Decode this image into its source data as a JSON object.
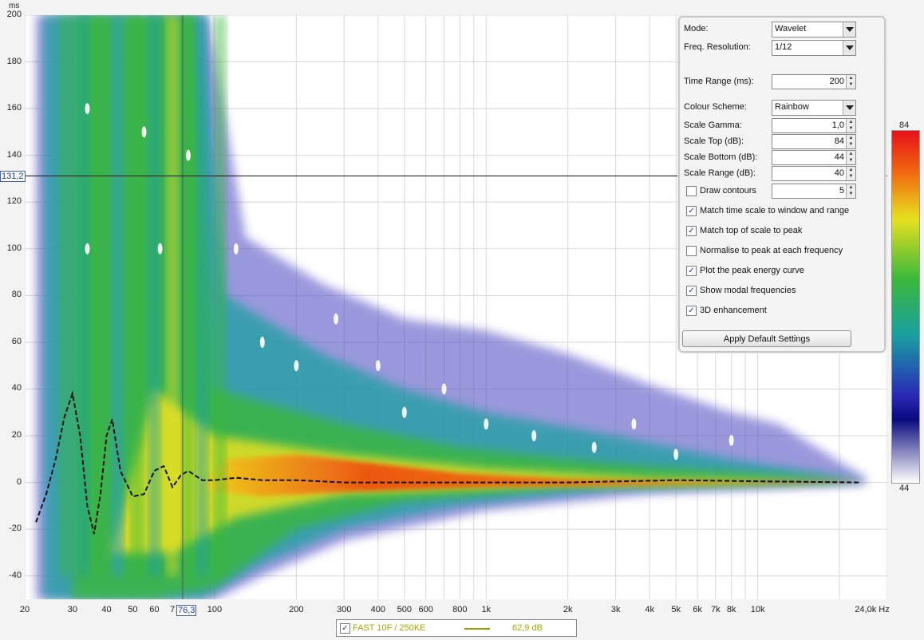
{
  "chart_data": {
    "type": "heatmap",
    "subtype": "wavelet spectrogram",
    "x_unit": "Hz",
    "y_unit": "ms",
    "x_scale": "log",
    "xlim": [
      20,
      30000
    ],
    "ylim": [
      -50,
      200
    ],
    "grid": true,
    "x_ticks": [
      {
        "value": 20,
        "label": "20"
      },
      {
        "value": 30,
        "label": "30"
      },
      {
        "value": 40,
        "label": "40"
      },
      {
        "value": 50,
        "label": "50"
      },
      {
        "value": 60,
        "label": "60"
      },
      {
        "value": 70,
        "label": "7"
      },
      {
        "value": 100,
        "label": "100"
      },
      {
        "value": 200,
        "label": "200"
      },
      {
        "value": 300,
        "label": "300"
      },
      {
        "value": 400,
        "label": "400"
      },
      {
        "value": 500,
        "label": "500"
      },
      {
        "value": 600,
        "label": "600"
      },
      {
        "value": 800,
        "label": "800"
      },
      {
        "value": 1000,
        "label": "1k"
      },
      {
        "value": 2000,
        "label": "2k"
      },
      {
        "value": 3000,
        "label": "3k"
      },
      {
        "value": 4000,
        "label": "4k"
      },
      {
        "value": 5000,
        "label": "5k"
      },
      {
        "value": 6000,
        "label": "6k"
      },
      {
        "value": 7000,
        "label": "7k"
      },
      {
        "value": 8000,
        "label": "8k"
      },
      {
        "value": 10000,
        "label": "10k"
      },
      {
        "value": 24000,
        "label": "24,0k Hz"
      }
    ],
    "y_ticks": [
      -40,
      -20,
      0,
      20,
      40,
      60,
      80,
      100,
      120,
      140,
      160,
      180,
      200
    ],
    "cursor": {
      "x_label": "76,3",
      "x_value": 76.3,
      "y_label": "131,2",
      "y_value": 131.2
    },
    "peak_energy_curve": {
      "x": [
        22,
        24,
        26,
        28,
        30,
        32,
        34,
        36,
        38,
        40,
        42,
        45,
        50,
        55,
        60,
        65,
        70,
        75,
        80,
        90,
        100,
        120,
        150,
        200,
        300,
        500,
        1000,
        2000,
        5000,
        10000,
        24000
      ],
      "y": [
        -17,
        -5,
        10,
        28,
        38,
        20,
        -10,
        -22,
        -5,
        20,
        27,
        5,
        -6,
        -5,
        5,
        7,
        -2,
        3,
        5,
        1,
        1,
        2,
        1,
        1,
        0,
        0,
        0,
        0,
        1,
        0.5,
        0
      ]
    },
    "colour_scale": {
      "top": 84,
      "bottom": 44,
      "top_label": "84",
      "bottom_label": "44"
    }
  },
  "axis_units": {
    "y": "ms"
  },
  "settings": {
    "mode_label": "Mode:",
    "mode_value": "Wavelet",
    "freq_res_label": "Freq. Resolution:",
    "freq_res_value": "1/12",
    "time_range_label": "Time Range (ms):",
    "time_range_value": "200",
    "colour_scheme_label": "Colour Scheme:",
    "colour_scheme_value": "Rainbow",
    "scale_gamma_label": "Scale Gamma:",
    "scale_gamma_value": "1,0",
    "scale_top_label": "Scale Top (dB):",
    "scale_top_value": "84",
    "scale_bottom_label": "Scale Bottom (dB):",
    "scale_bottom_value": "44",
    "scale_range_label": "Scale Range (dB):",
    "scale_range_value": "40",
    "draw_contours_label": "Draw contours",
    "draw_contours_value": "5",
    "draw_contours_checked": false,
    "options": [
      {
        "label": "Match time scale to window and range",
        "checked": true
      },
      {
        "label": "Match top of scale to peak",
        "checked": true
      },
      {
        "label": "Normalise to peak at each frequency",
        "checked": false
      },
      {
        "label": "Plot the peak energy curve",
        "checked": true
      },
      {
        "label": "Show modal frequencies",
        "checked": true
      },
      {
        "label": "3D enhancement",
        "checked": true
      }
    ],
    "apply_label": "Apply Default Settings"
  },
  "legend": {
    "series_label": "FAST 10F / 250KE",
    "value": "62,9 dB",
    "checked": true,
    "line_color": "#9c9c00"
  }
}
